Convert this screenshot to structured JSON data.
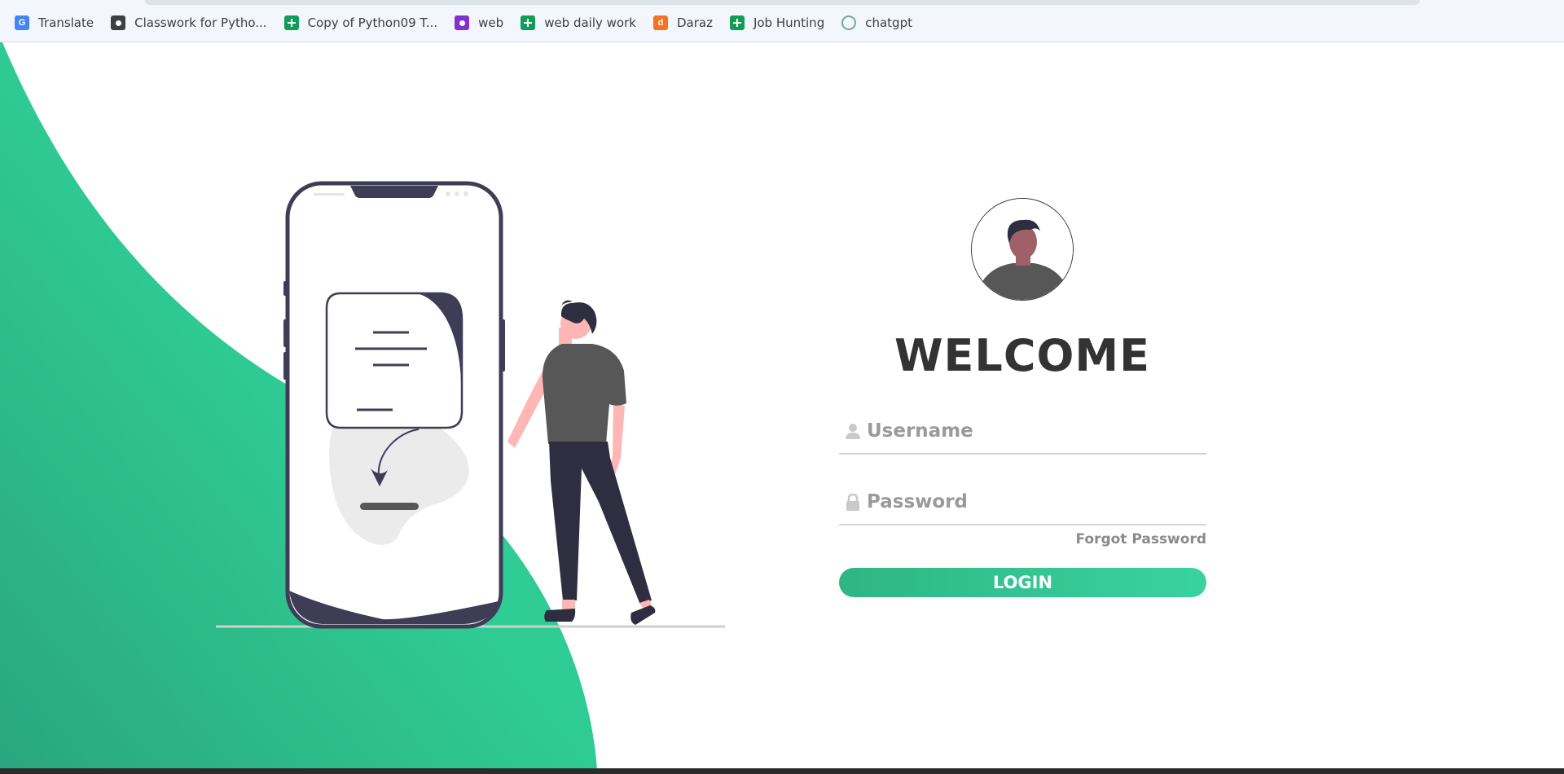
{
  "bookmarks": [
    {
      "label": "Translate",
      "icon": "translate-icon"
    },
    {
      "label": "Classwork for Pytho...",
      "icon": "classroom-icon"
    },
    {
      "label": "Copy of Python09 T...",
      "icon": "sheets-icon"
    },
    {
      "label": "web",
      "icon": "classroom-icon"
    },
    {
      "label": "web daily work",
      "icon": "sheets-icon"
    },
    {
      "label": "Daraz",
      "icon": "daraz-icon"
    },
    {
      "label": "Job Hunting",
      "icon": "sheets-icon"
    },
    {
      "label": "chatgpt",
      "icon": "chatgpt-icon"
    }
  ],
  "login": {
    "title": "WELCOME",
    "username_placeholder": "Username",
    "password_placeholder": "Password",
    "forgot_label": "Forgot Password",
    "button_label": "LOGIN"
  },
  "colors": {
    "accent": "#38d39f",
    "accent_dark": "#2fb585",
    "text_dark": "#333333"
  }
}
